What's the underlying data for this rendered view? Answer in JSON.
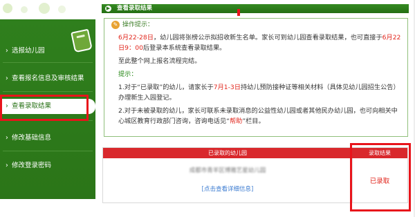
{
  "sidebar": {
    "items": [
      {
        "label": "选报幼儿园"
      },
      {
        "label": "查看报名信息及审核结果"
      },
      {
        "label": "查看录取结果"
      },
      {
        "label": "修改基础信息"
      },
      {
        "label": "修改登录密码"
      }
    ],
    "active_index": 2
  },
  "header": {
    "title": "查看录取结果"
  },
  "notice": {
    "title": "操作提示：",
    "p1_date1": "6月22-28日",
    "p1_mid": "，幼儿园将张榜公示拟招收新生名单。家长可到幼儿园查看录取结果，也可直接于",
    "p1_date2": "6月22日9：00",
    "p1_end": "后登录本系统查看录取结果。",
    "p2": "至此整个网上报名流程完结。",
    "tips_label": "提示：",
    "tip1_start": "1.对于“已录取”的幼儿，请家长于",
    "tip1_date": "7月1-3日",
    "tip1_end": "持幼儿预防接种证等相关材料（具体见幼儿园招生公告）办理新生入园登记。",
    "tip2_start": "2.对于未被录取的幼儿，家长可联系未录取消息的公益性幼儿园或者其他民办幼儿园，也可向相关中心城区教育行政部门咨询，咨询电话见“",
    "tip2_link": "帮助",
    "tip2_end": "”栏目。"
  },
  "result": {
    "col_school": "已录取的幼儿园",
    "col_status": "录取结果",
    "school_name": "成都市青羊区博雅艺星幼儿园",
    "detail_link": "[点击查看详细信息]",
    "status": "已录取"
  },
  "colors": {
    "sidebar_green": "#2b7518",
    "accent_red": "#e1261c",
    "header_red": "#d9282c",
    "highlight_box": "#e8141b"
  }
}
